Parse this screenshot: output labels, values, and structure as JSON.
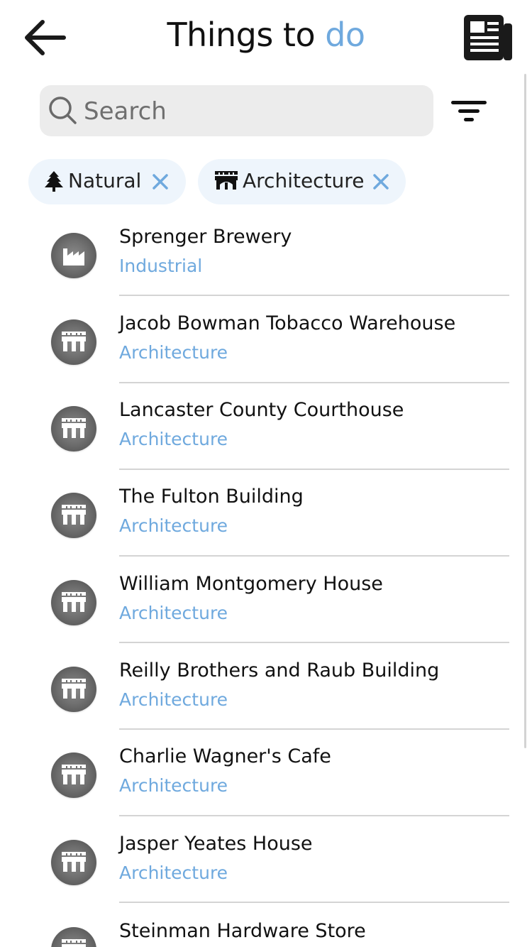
{
  "header": {
    "title_main": "Things to ",
    "title_accent": "do"
  },
  "search": {
    "placeholder": "Search",
    "value": ""
  },
  "filters": [
    {
      "label": "Natural",
      "icon": "tree-icon"
    },
    {
      "label": "Architecture",
      "icon": "bridge-icon"
    }
  ],
  "items": [
    {
      "name": "Sprenger Brewery",
      "category": "Industrial",
      "icon": "factory-icon"
    },
    {
      "name": "Jacob Bowman Tobacco Warehouse",
      "category": "Architecture",
      "icon": "bridge-icon"
    },
    {
      "name": "Lancaster County Courthouse",
      "category": "Architecture",
      "icon": "bridge-icon"
    },
    {
      "name": "The Fulton Building",
      "category": "Architecture",
      "icon": "bridge-icon"
    },
    {
      "name": "William Montgomery House",
      "category": "Architecture",
      "icon": "bridge-icon"
    },
    {
      "name": "Reilly Brothers and Raub Building",
      "category": "Architecture",
      "icon": "bridge-icon"
    },
    {
      "name": "Charlie Wagner's Cafe",
      "category": "Architecture",
      "icon": "bridge-icon"
    },
    {
      "name": "Jasper Yeates House",
      "category": "Architecture",
      "icon": "bridge-icon"
    },
    {
      "name": "Steinman Hardware Store",
      "category": "",
      "icon": "bridge-icon"
    }
  ],
  "colors": {
    "accent": "#6fa9de",
    "chip_bg": "#eef5fc",
    "search_bg": "#ececec"
  }
}
